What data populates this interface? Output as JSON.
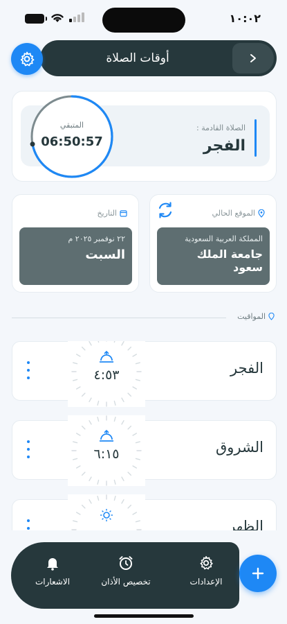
{
  "status_bar": {
    "time": "١٠:٠٢"
  },
  "header": {
    "title": "أوقات الصلاة"
  },
  "next_prayer": {
    "label": "الصلاة القادمة :",
    "name": "الفجر",
    "remaining_label": "المتبقي",
    "remaining_time": "06:50:57",
    "remaining_fraction": 0.72
  },
  "location_card": {
    "heading": "الموقع الحالي",
    "country": "المملكة العربية السعودية",
    "place": "جامعة الملك سعود"
  },
  "date_card": {
    "heading": "التاريخ",
    "date": "٢٢ نوفمبر ٢٠٢٥ م",
    "day": "السبت"
  },
  "section": {
    "label": "المواقيت"
  },
  "prayers": [
    {
      "name": "الفجر",
      "time": "٤:٥٣",
      "icon": "sunrise-icon"
    },
    {
      "name": "الشروق",
      "time": "٦:١٥",
      "icon": "sunrise-icon"
    },
    {
      "name": "الظهر",
      "time": "",
      "icon": "sun-icon"
    }
  ],
  "bottom_nav": {
    "settings": "الإعدادات",
    "adhan": "تخصيص الأذان",
    "notifications": "الاشعارات"
  },
  "colors": {
    "accent": "#1e88f5",
    "dark": "#26383c",
    "card_box": "#5e6e71"
  }
}
